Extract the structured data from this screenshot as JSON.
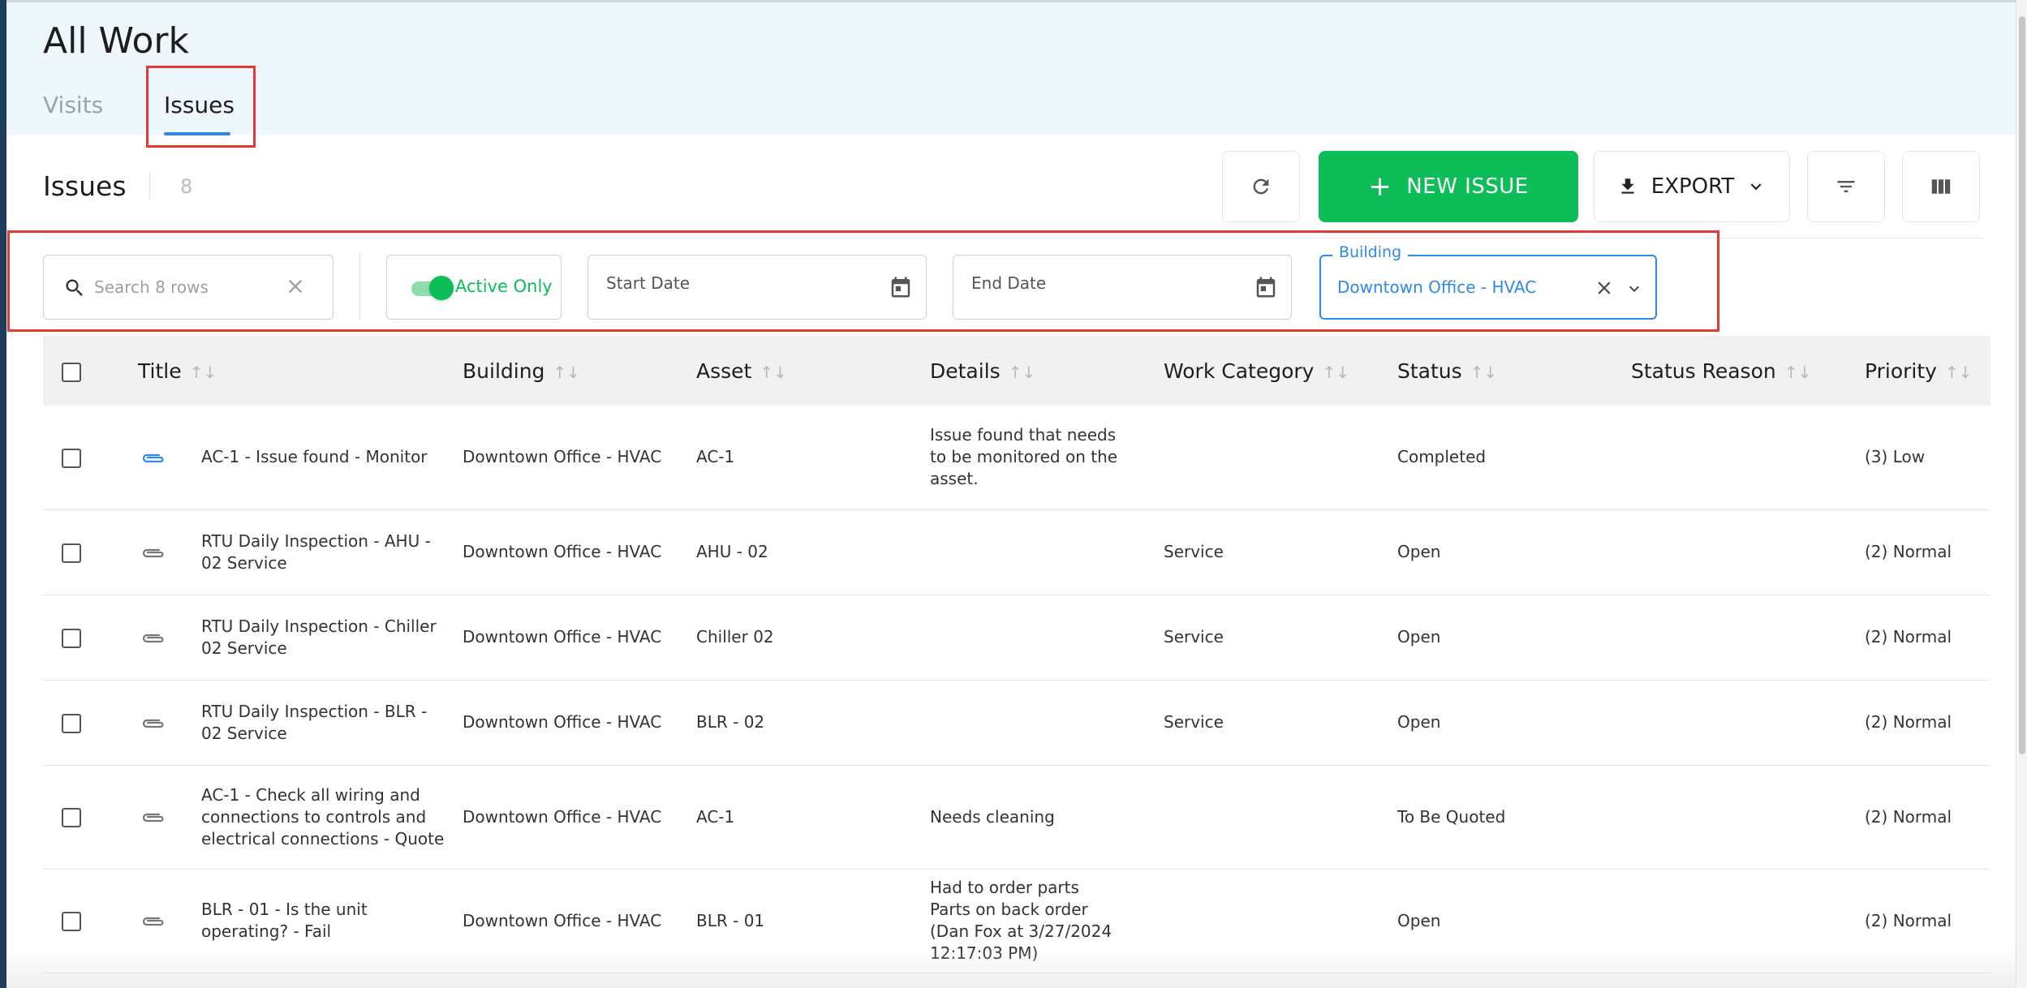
{
  "header": {
    "title": "All Work",
    "tabs": [
      {
        "label": "Visits",
        "active": false
      },
      {
        "label": "Issues",
        "active": true
      }
    ]
  },
  "toolbar": {
    "section_title": "Issues",
    "count": "8",
    "new_issue_label": "NEW ISSUE",
    "export_label": "EXPORT",
    "accent_color": "#0dbd58",
    "link_color": "#2e8ae6"
  },
  "filters": {
    "search_placeholder": "Search 8 rows",
    "active_only_label": "Active Only",
    "active_only_on": true,
    "start_date_label": "Start Date",
    "end_date_label": "End Date",
    "building_label": "Building",
    "building_value": "Downtown Office - HVAC"
  },
  "table": {
    "columns": [
      "Title",
      "Building",
      "Asset",
      "Details",
      "Work Category",
      "Status",
      "Status Reason",
      "Priority"
    ],
    "rows": [
      {
        "title": "AC-1 - Issue found - Monitor",
        "building": "Downtown Office - HVAC",
        "asset": "AC-1",
        "details": "Issue found that needs to be monitored on the asset.",
        "category": "",
        "status": "Completed",
        "status_reason": "",
        "priority": "(3) Low",
        "attachment": true
      },
      {
        "title": "RTU Daily Inspection - AHU - 02 Service",
        "building": "Downtown Office - HVAC",
        "asset": "AHU - 02",
        "details": "",
        "category": "Service",
        "status": "Open",
        "status_reason": "",
        "priority": "(2) Normal",
        "attachment": false
      },
      {
        "title": "RTU Daily Inspection - Chiller 02 Service",
        "building": "Downtown Office - HVAC",
        "asset": "Chiller 02",
        "details": "",
        "category": "Service",
        "status": "Open",
        "status_reason": "",
        "priority": "(2) Normal",
        "attachment": false
      },
      {
        "title": "RTU Daily Inspection - BLR - 02 Service",
        "building": "Downtown Office - HVAC",
        "asset": "BLR - 02",
        "details": "",
        "category": "Service",
        "status": "Open",
        "status_reason": "",
        "priority": "(2) Normal",
        "attachment": false
      },
      {
        "title": "AC-1 - Check all wiring and connections to controls and electrical connections - Quote",
        "building": "Downtown Office - HVAC",
        "asset": "AC-1",
        "details": "Needs cleaning",
        "category": "",
        "status": "To Be Quoted",
        "status_reason": "",
        "priority": "(2) Normal",
        "attachment": false
      },
      {
        "title": "BLR - 01 - Is the unit operating? - Fail",
        "building": "Downtown Office - HVAC",
        "asset": "BLR - 01",
        "details": "Had to order parts Parts on back order (Dan Fox at 3/27/2024 12:17:03 PM)",
        "category": "",
        "status": "Open",
        "status_reason": "",
        "priority": "(2) Normal",
        "attachment": false
      }
    ]
  }
}
